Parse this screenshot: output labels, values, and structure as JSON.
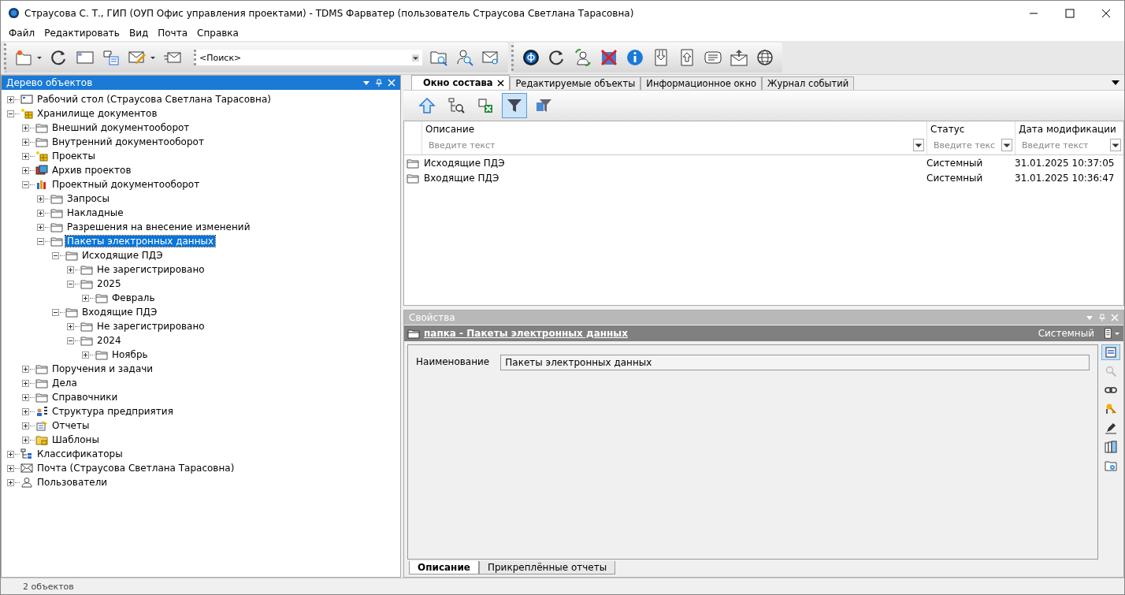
{
  "window": {
    "title": "Страусова С. Т., ГИП (ОУП Офис управления проектами) - TDMS Фарватер (пользователь Страусова Светлана Тарасовна)"
  },
  "menu": [
    "Файл",
    "Редактировать",
    "Вид",
    "Почта",
    "Справка"
  ],
  "toolbar": {
    "search_value": "<Поиск>"
  },
  "tree_panel": {
    "title": "Дерево объектов"
  },
  "tree": [
    {
      "label": "Рабочий стол (Страусова Светлана Тарасовна)",
      "kind": "desktop",
      "expanded": false,
      "selected": false
    },
    {
      "label": "Хранилище документов",
      "kind": "storage",
      "expanded": true,
      "selected": false,
      "children": [
        {
          "label": "Внешний документооборот",
          "kind": "folder",
          "expanded": false,
          "selected": false
        },
        {
          "label": "Внутренний документооборот",
          "kind": "folder",
          "expanded": false,
          "selected": false
        },
        {
          "label": "Проекты",
          "kind": "storage",
          "expanded": false,
          "selected": false
        },
        {
          "label": "Архив проектов",
          "kind": "archive",
          "expanded": false,
          "selected": false
        },
        {
          "label": "Проектный документооборот",
          "kind": "chart",
          "expanded": true,
          "selected": false,
          "children": [
            {
              "label": "Запросы",
              "kind": "folder",
              "expanded": false,
              "selected": false
            },
            {
              "label": "Накладные",
              "kind": "folder",
              "expanded": false,
              "selected": false
            },
            {
              "label": "Разрешения на внесение изменений",
              "kind": "folder",
              "expanded": false,
              "selected": false
            },
            {
              "label": "Пакеты электронных данных",
              "kind": "folder",
              "expanded": true,
              "selected": true,
              "children": [
                {
                  "label": "Исходящие ПДЭ",
                  "kind": "folder",
                  "expanded": true,
                  "selected": false,
                  "children": [
                    {
                      "label": "Не зарегистрировано",
                      "kind": "folder",
                      "expanded": false,
                      "selected": false
                    },
                    {
                      "label": "2025",
                      "kind": "folder",
                      "expanded": true,
                      "selected": false,
                      "children": [
                        {
                          "label": "Февраль",
                          "kind": "folder",
                          "expanded": false,
                          "selected": false
                        }
                      ]
                    }
                  ]
                },
                {
                  "label": "Входящие ПДЭ",
                  "kind": "folder",
                  "expanded": true,
                  "selected": false,
                  "children": [
                    {
                      "label": "Не зарегистрировано",
                      "kind": "folder",
                      "expanded": false,
                      "selected": false
                    },
                    {
                      "label": "2024",
                      "kind": "folder",
                      "expanded": true,
                      "selected": false,
                      "children": [
                        {
                          "label": "Ноябрь",
                          "kind": "folder",
                          "expanded": false,
                          "selected": false
                        }
                      ]
                    }
                  ]
                }
              ]
            }
          ]
        },
        {
          "label": "Поручения и задачи",
          "kind": "folder",
          "expanded": false,
          "selected": false
        },
        {
          "label": "Дела",
          "kind": "folder",
          "expanded": false,
          "selected": false
        },
        {
          "label": "Справочники",
          "kind": "folder",
          "expanded": false,
          "selected": false
        },
        {
          "label": "Структура предприятия",
          "kind": "orgchart",
          "expanded": false,
          "selected": false
        },
        {
          "label": "Отчеты",
          "kind": "reports",
          "expanded": false,
          "selected": false
        },
        {
          "label": "Шаблоны",
          "kind": "templates",
          "expanded": false,
          "selected": false
        }
      ]
    },
    {
      "label": "Классификаторы",
      "kind": "classifier",
      "expanded": false,
      "selected": false
    },
    {
      "label": "Почта (Страусова Светлана Тарасовна)",
      "kind": "mail",
      "expanded": false,
      "selected": false
    },
    {
      "label": "Пользователи",
      "kind": "user",
      "expanded": false,
      "selected": false
    }
  ],
  "tabs": [
    {
      "label": "Окно состава",
      "selected": true
    },
    {
      "label": "Редактируемые объекты",
      "selected": false
    },
    {
      "label": "Информационное окно",
      "selected": false
    },
    {
      "label": "Журнал событий",
      "selected": false
    }
  ],
  "sub_toolbar": [
    {
      "kind": "up",
      "on": false
    },
    {
      "kind": "tree-search",
      "on": false
    },
    {
      "kind": "excel",
      "on": false
    },
    {
      "kind": "filter",
      "on": true
    },
    {
      "kind": "filter-table",
      "on": false
    }
  ],
  "table": {
    "columns": [
      {
        "label": "Описание",
        "placeholder": "Введите текст"
      },
      {
        "label": "Статус",
        "placeholder": "Введите текс"
      },
      {
        "label": "Дата модификации",
        "placeholder": "Введите текст"
      }
    ],
    "rows": [
      {
        "description": "Исходящие ПДЭ",
        "status": "Системный",
        "modified": "31.01.2025 10:37:05"
      },
      {
        "description": "Входящие ПДЭ",
        "status": "Системный",
        "modified": "31.01.2025 10:36:47"
      }
    ]
  },
  "properties": {
    "title": "Свойства",
    "object": "папка - Пакеты электронных данных",
    "status": "Системный",
    "fields": [
      {
        "label": "Наименование",
        "value": "Пакеты электронных данных"
      }
    ],
    "side_tools": [
      {
        "kind": "form",
        "selected": true
      },
      {
        "kind": "search",
        "selected": false
      },
      {
        "kind": "link",
        "selected": false
      },
      {
        "kind": "keys",
        "selected": false
      },
      {
        "kind": "pen",
        "selected": false
      },
      {
        "kind": "books",
        "selected": false
      },
      {
        "kind": "folder-gear",
        "selected": false
      }
    ],
    "tabs": [
      {
        "label": "Описание",
        "selected": true
      },
      {
        "label": "Прикреплённые отчеты",
        "selected": false
      }
    ]
  },
  "status_bar": "2 объектов"
}
